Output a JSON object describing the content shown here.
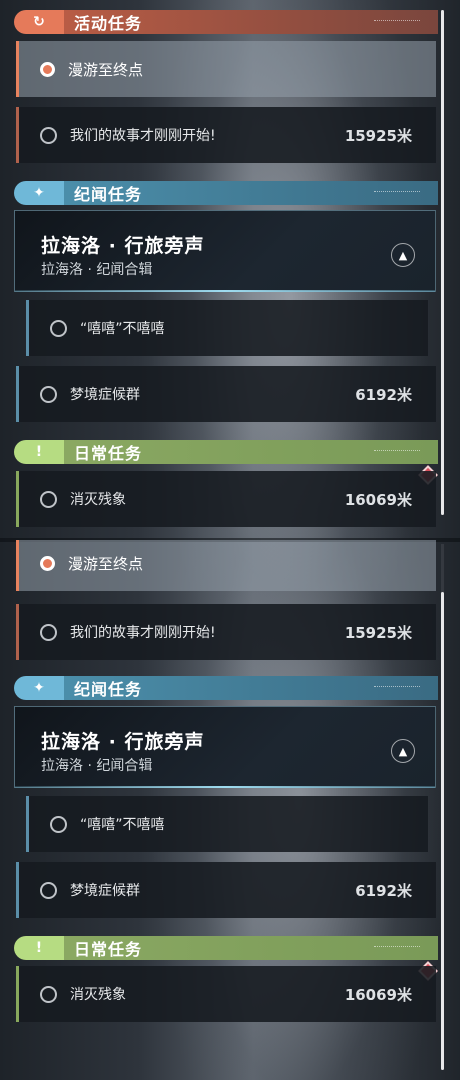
{
  "activity": {
    "header_title": "活动任务",
    "header_icon": "rotate-arrow-icon",
    "quest_1": "漫游至终点",
    "quest_2": "我们的故事才刚刚开始!",
    "quest_2_distance": "15925米"
  },
  "story": {
    "header_title": "纪闻任务",
    "header_icon": "sparkle-icon",
    "card_title": "拉海洛 · 行旅旁声",
    "card_subtitle": "拉海洛 · 纪闻合辑",
    "quest_1": "“嘻嘻”不嘻嘻",
    "quest_2": "梦境症候群",
    "quest_2_distance": "6192米"
  },
  "daily": {
    "header_title": "日常任务",
    "header_icon": "exclamation-icon",
    "quest_1": "消灭残象",
    "quest_1_distance": "16069米"
  },
  "colors": {
    "activity_accent": "#e57a5a",
    "story_accent": "#6fb8d8",
    "daily_accent": "#b6dc82",
    "marker": "#d9505c"
  }
}
